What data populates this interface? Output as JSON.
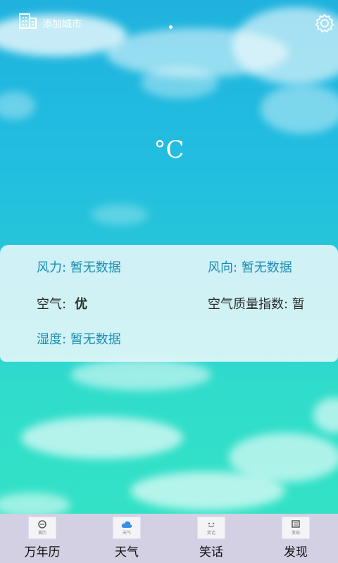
{
  "header": {
    "add_city_label": "添加城市"
  },
  "weather": {
    "temperature_unit": "°C"
  },
  "details": {
    "wind_power": {
      "label": "风力:",
      "value": " 暂无数据"
    },
    "wind_direction": {
      "label": "风向:",
      "value": " 暂无数据"
    },
    "air": {
      "label": "空气:",
      "value": "优"
    },
    "aqi": {
      "label": "空气质量指数:",
      "value": " 暂"
    },
    "humidity": {
      "label": "湿度:",
      "value": " 暂无数据"
    }
  },
  "tabs": [
    {
      "label": "万年历",
      "icon": "calendar-icon",
      "icon_caption": "黄历"
    },
    {
      "label": "天气",
      "icon": "weather-icon",
      "icon_caption": "天气"
    },
    {
      "label": "笑话",
      "icon": "joke-icon",
      "icon_caption": "笑话"
    },
    {
      "label": "发现",
      "icon": "discover-icon",
      "icon_caption": "发现"
    }
  ],
  "colors": {
    "sky_top": "#1fb2de",
    "sky_bottom": "#33e2c6",
    "accent_text": "#1b8db3",
    "tab_bar": "#d4d0e4"
  }
}
